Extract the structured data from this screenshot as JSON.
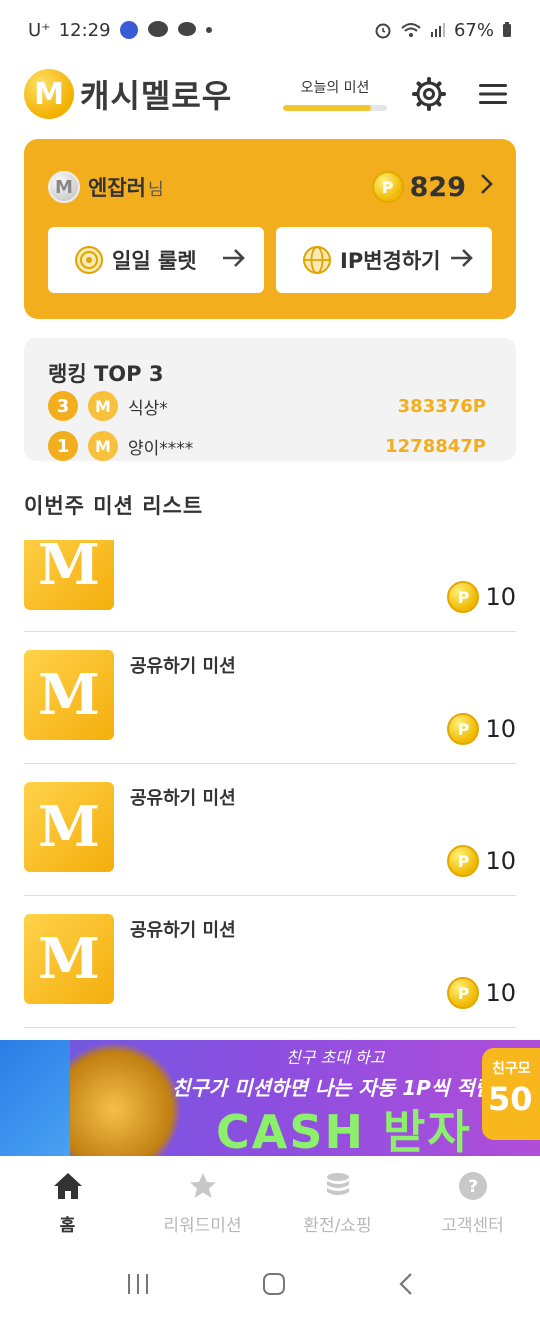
{
  "status_bar": {
    "carrier": "U⁺",
    "time": "12:29",
    "battery": "67%"
  },
  "header": {
    "logo_letter": "M",
    "brand": "캐시멜로우",
    "mission_today_label": "오늘의 미션",
    "mission_today_progress": 0.85
  },
  "user_card": {
    "avatar_letter": "M",
    "username": "엔잡러",
    "honorific": "님",
    "coin_symbol": "P",
    "points": "829",
    "roulette_label": "일일 룰렛",
    "ip_change_label": "IP변경하기"
  },
  "ranking": {
    "title": "랭킹 TOP 3",
    "rows": [
      {
        "rank": "3",
        "name": "식상*",
        "points": "383376P"
      },
      {
        "rank": "1",
        "name": "양이****",
        "points": "1278847P"
      }
    ]
  },
  "missions": {
    "section_title": "이번주 미션 리스트",
    "items": [
      {
        "title": "",
        "reward": "10"
      },
      {
        "title": "공유하기 미션",
        "reward": "10"
      },
      {
        "title": "공유하기 미션",
        "reward": "10"
      },
      {
        "title": "공유하기 미션",
        "reward": "10"
      }
    ]
  },
  "banner": {
    "line1": "친구 초대 하고",
    "line2": "친구가 미션하면 나는 자동 1P씩 적립!",
    "line3": "CASH 받자",
    "badge_top": "친구모",
    "badge_value": "50"
  },
  "bottom_nav": {
    "items": [
      {
        "label": "홈",
        "active": true
      },
      {
        "label": "리워드미션",
        "active": false
      },
      {
        "label": "환전/쇼핑",
        "active": false
      },
      {
        "label": "고객센터",
        "active": false
      }
    ]
  },
  "colors": {
    "accent": "#f2ae1c",
    "coin": "#f0b800",
    "banner": "#8d4ee0"
  }
}
